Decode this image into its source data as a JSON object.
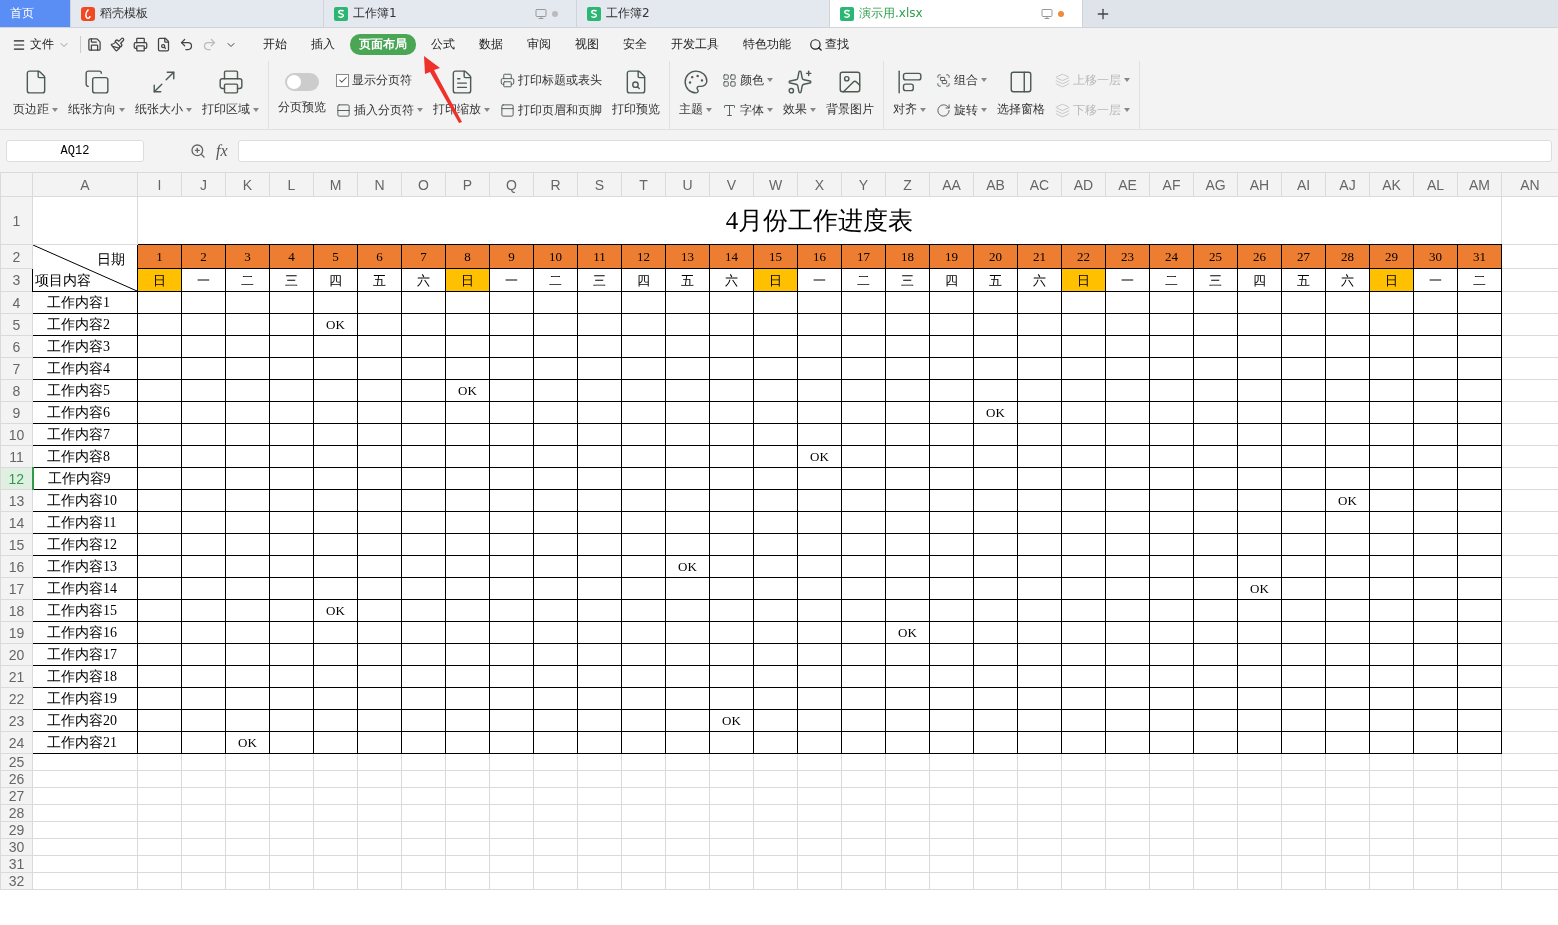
{
  "tabs": [
    {
      "label": "首页",
      "kind": "home",
      "selected": false
    },
    {
      "label": "稻壳模板",
      "kind": "docer",
      "selected": false
    },
    {
      "label": "工作簿1",
      "kind": "sheet",
      "selected": false,
      "modified": false
    },
    {
      "label": "工作簿2",
      "kind": "sheet",
      "selected": false
    },
    {
      "label": "演示用.xlsx",
      "kind": "sheet",
      "selected": true,
      "modified": true
    }
  ],
  "menu": {
    "file": "文件",
    "items": [
      {
        "label": "开始",
        "selected": false
      },
      {
        "label": "插入",
        "selected": false
      },
      {
        "label": "页面布局",
        "selected": true
      },
      {
        "label": "公式",
        "selected": false
      },
      {
        "label": "数据",
        "selected": false
      },
      {
        "label": "审阅",
        "selected": false
      },
      {
        "label": "视图",
        "selected": false
      },
      {
        "label": "安全",
        "selected": false
      },
      {
        "label": "开发工具",
        "selected": false
      },
      {
        "label": "特色功能",
        "selected": false
      }
    ],
    "search": "查找"
  },
  "ribbon": [
    [
      [
        {
          "kind": "large",
          "label": "页边距",
          "dropdown": true
        }
      ],
      [
        {
          "kind": "large",
          "label": "纸张方向",
          "dropdown": true
        }
      ],
      [
        {
          "kind": "large",
          "label": "纸张大小",
          "dropdown": true
        }
      ],
      [
        {
          "kind": "large",
          "label": "打印区域",
          "dropdown": true
        }
      ]
    ],
    [
      [
        {
          "kind": "toggle",
          "label": "分页预览",
          "on": false
        }
      ],
      [
        {
          "kind": "check",
          "label": "显示分页符",
          "checked": true
        },
        {
          "kind": "small",
          "label": "插入分页符",
          "dropdown": true
        }
      ],
      [
        {
          "kind": "large",
          "label": "打印缩放",
          "dropdown": true
        }
      ],
      [
        {
          "kind": "small",
          "label": "打印标题或表头"
        },
        {
          "kind": "small",
          "label": "打印页眉和页脚"
        }
      ],
      [
        {
          "kind": "large",
          "label": "打印预览"
        }
      ]
    ],
    [
      [
        {
          "kind": "large",
          "label": "主题",
          "dropdown": true
        }
      ],
      [
        {
          "kind": "small",
          "label": "颜色",
          "dropdown": true
        },
        {
          "kind": "small",
          "label": "字体",
          "dropdown": true
        }
      ],
      [
        {
          "kind": "large",
          "label": "效果",
          "dropdown": true
        }
      ],
      [
        {
          "kind": "large",
          "label": "背景图片"
        }
      ]
    ],
    [
      [
        {
          "kind": "large",
          "label": "对齐",
          "dropdown": true
        }
      ],
      [
        {
          "kind": "small",
          "label": "组合",
          "dropdown": true
        },
        {
          "kind": "small",
          "label": "旋转",
          "dropdown": true
        }
      ],
      [
        {
          "kind": "large",
          "label": "选择窗格"
        }
      ],
      [
        {
          "kind": "small",
          "label": "上移一层",
          "dropdown": true,
          "disabled": true
        },
        {
          "kind": "small",
          "label": "下移一层",
          "dropdown": true,
          "disabled": true
        }
      ]
    ]
  ],
  "formula_bar": {
    "name_box": "AQ12",
    "fx": "fx"
  },
  "sheet": {
    "columns": [
      "A",
      "I",
      "J",
      "K",
      "L",
      "M",
      "N",
      "O",
      "P",
      "Q",
      "R",
      "S",
      "T",
      "U",
      "V",
      "W",
      "X",
      "Y",
      "Z",
      "AA",
      "AB",
      "AC",
      "AD",
      "AE",
      "AF",
      "AG",
      "AH",
      "AI",
      "AJ",
      "AK",
      "AL",
      "AM",
      "AN"
    ],
    "rows": [
      {
        "n": "1",
        "selected": false
      },
      {
        "n": "2",
        "selected": false
      },
      {
        "n": "3",
        "selected": false
      },
      {
        "n": "4",
        "selected": false
      },
      {
        "n": "5",
        "selected": false
      },
      {
        "n": "6",
        "selected": false
      },
      {
        "n": "7",
        "selected": false
      },
      {
        "n": "8",
        "selected": false
      },
      {
        "n": "9",
        "selected": false
      },
      {
        "n": "10",
        "selected": false
      },
      {
        "n": "11",
        "selected": false
      },
      {
        "n": "12",
        "selected": true
      },
      {
        "n": "13",
        "selected": false
      },
      {
        "n": "14",
        "selected": false
      },
      {
        "n": "15",
        "selected": false
      },
      {
        "n": "16",
        "selected": false
      },
      {
        "n": "17",
        "selected": false
      },
      {
        "n": "18",
        "selected": false
      },
      {
        "n": "19",
        "selected": false
      },
      {
        "n": "20",
        "selected": false
      },
      {
        "n": "21",
        "selected": false
      },
      {
        "n": "22",
        "selected": false
      },
      {
        "n": "23",
        "selected": false
      },
      {
        "n": "24",
        "selected": false
      },
      {
        "n": "25",
        "selected": false
      },
      {
        "n": "26",
        "selected": false
      },
      {
        "n": "27",
        "selected": false
      },
      {
        "n": "28",
        "selected": false
      },
      {
        "n": "29",
        "selected": false
      },
      {
        "n": "30",
        "selected": false
      },
      {
        "n": "31",
        "selected": false
      },
      {
        "n": "32",
        "selected": false
      }
    ],
    "title": "4月份工作进度表",
    "corner_top": "日期",
    "corner_bottom": "项目内容",
    "days": [
      {
        "day": "1",
        "weekday": "日",
        "highlight": true
      },
      {
        "day": "2",
        "weekday": "一",
        "highlight": false
      },
      {
        "day": "3",
        "weekday": "二",
        "highlight": false
      },
      {
        "day": "4",
        "weekday": "三",
        "highlight": false
      },
      {
        "day": "5",
        "weekday": "四",
        "highlight": false
      },
      {
        "day": "6",
        "weekday": "五",
        "highlight": false
      },
      {
        "day": "7",
        "weekday": "六",
        "highlight": false
      },
      {
        "day": "8",
        "weekday": "日",
        "highlight": true
      },
      {
        "day": "9",
        "weekday": "一",
        "highlight": false
      },
      {
        "day": "10",
        "weekday": "二",
        "highlight": false
      },
      {
        "day": "11",
        "weekday": "三",
        "highlight": false
      },
      {
        "day": "12",
        "weekday": "四",
        "highlight": false
      },
      {
        "day": "13",
        "weekday": "五",
        "highlight": false
      },
      {
        "day": "14",
        "weekday": "六",
        "highlight": false
      },
      {
        "day": "15",
        "weekday": "日",
        "highlight": true
      },
      {
        "day": "16",
        "weekday": "一",
        "highlight": false
      },
      {
        "day": "17",
        "weekday": "二",
        "highlight": false
      },
      {
        "day": "18",
        "weekday": "三",
        "highlight": false
      },
      {
        "day": "19",
        "weekday": "四",
        "highlight": false
      },
      {
        "day": "20",
        "weekday": "五",
        "highlight": false
      },
      {
        "day": "21",
        "weekday": "六",
        "highlight": false
      },
      {
        "day": "22",
        "weekday": "日",
        "highlight": true
      },
      {
        "day": "23",
        "weekday": "一",
        "highlight": false
      },
      {
        "day": "24",
        "weekday": "二",
        "highlight": false
      },
      {
        "day": "25",
        "weekday": "三",
        "highlight": false
      },
      {
        "day": "26",
        "weekday": "四",
        "highlight": false
      },
      {
        "day": "27",
        "weekday": "五",
        "highlight": false
      },
      {
        "day": "28",
        "weekday": "六",
        "highlight": false
      },
      {
        "day": "29",
        "weekday": "日",
        "highlight": true
      },
      {
        "day": "30",
        "weekday": "一",
        "highlight": false
      },
      {
        "day": "31",
        "weekday": "二",
        "highlight": false
      }
    ],
    "tasks": [
      {
        "label": "工作内容1",
        "cells": [
          null,
          null,
          null,
          null,
          null,
          null,
          null,
          null,
          null,
          null,
          null,
          null,
          null,
          null,
          null,
          null,
          null,
          null,
          null,
          null,
          null,
          null,
          null,
          null,
          null,
          null,
          null,
          null,
          null,
          null,
          null
        ]
      },
      {
        "label": "工作内容2",
        "cells": [
          null,
          null,
          null,
          null,
          "OK",
          null,
          null,
          null,
          null,
          null,
          null,
          null,
          null,
          null,
          null,
          null,
          null,
          null,
          null,
          null,
          null,
          null,
          null,
          null,
          null,
          null,
          null,
          null,
          null,
          null,
          null
        ]
      },
      {
        "label": "工作内容3",
        "cells": [
          null,
          null,
          null,
          null,
          null,
          null,
          null,
          null,
          null,
          null,
          null,
          null,
          null,
          null,
          null,
          null,
          null,
          null,
          null,
          null,
          null,
          null,
          null,
          null,
          null,
          null,
          null,
          null,
          null,
          null,
          null
        ]
      },
      {
        "label": "工作内容4",
        "cells": [
          null,
          null,
          null,
          null,
          null,
          null,
          null,
          null,
          null,
          null,
          null,
          null,
          null,
          null,
          null,
          null,
          null,
          null,
          null,
          null,
          null,
          null,
          null,
          null,
          null,
          null,
          null,
          null,
          null,
          null,
          null
        ]
      },
      {
        "label": "工作内容5",
        "cells": [
          null,
          null,
          null,
          null,
          null,
          null,
          null,
          "OK",
          null,
          null,
          null,
          null,
          null,
          null,
          null,
          null,
          null,
          null,
          null,
          null,
          null,
          null,
          null,
          null,
          null,
          null,
          null,
          null,
          null,
          null,
          null
        ]
      },
      {
        "label": "工作内容6",
        "cells": [
          null,
          null,
          null,
          null,
          null,
          null,
          null,
          null,
          null,
          null,
          null,
          null,
          null,
          null,
          null,
          null,
          null,
          null,
          null,
          "OK",
          null,
          null,
          null,
          null,
          null,
          null,
          null,
          null,
          null,
          null,
          null
        ]
      },
      {
        "label": "工作内容7",
        "cells": [
          null,
          null,
          null,
          null,
          null,
          null,
          null,
          null,
          null,
          null,
          null,
          null,
          null,
          null,
          null,
          null,
          null,
          null,
          null,
          null,
          null,
          null,
          null,
          null,
          null,
          null,
          null,
          null,
          null,
          null,
          null
        ]
      },
      {
        "label": "工作内容8",
        "cells": [
          null,
          null,
          null,
          null,
          null,
          null,
          null,
          null,
          null,
          null,
          null,
          null,
          null,
          null,
          null,
          "OK",
          null,
          null,
          null,
          null,
          null,
          null,
          null,
          null,
          null,
          null,
          null,
          null,
          null,
          null,
          null
        ]
      },
      {
        "label": "工作内容9",
        "cells": [
          null,
          null,
          null,
          null,
          null,
          null,
          null,
          null,
          null,
          null,
          null,
          null,
          null,
          null,
          null,
          null,
          null,
          null,
          null,
          null,
          null,
          null,
          null,
          null,
          null,
          null,
          null,
          null,
          null,
          null,
          null
        ]
      },
      {
        "label": "工作内容10",
        "cells": [
          null,
          null,
          null,
          null,
          null,
          null,
          null,
          null,
          null,
          null,
          null,
          null,
          null,
          null,
          null,
          null,
          null,
          null,
          null,
          null,
          null,
          null,
          null,
          null,
          null,
          null,
          null,
          "OK",
          null,
          null,
          null
        ]
      },
      {
        "label": "工作内容11",
        "cells": [
          null,
          null,
          null,
          null,
          null,
          null,
          null,
          null,
          null,
          null,
          null,
          null,
          null,
          null,
          null,
          null,
          null,
          null,
          null,
          null,
          null,
          null,
          null,
          null,
          null,
          null,
          null,
          null,
          null,
          null,
          null
        ]
      },
      {
        "label": "工作内容12",
        "cells": [
          null,
          null,
          null,
          null,
          null,
          null,
          null,
          null,
          null,
          null,
          null,
          null,
          null,
          null,
          null,
          null,
          null,
          null,
          null,
          null,
          null,
          null,
          null,
          null,
          null,
          null,
          null,
          null,
          null,
          null,
          null
        ]
      },
      {
        "label": "工作内容13",
        "cells": [
          null,
          null,
          null,
          null,
          null,
          null,
          null,
          null,
          null,
          null,
          null,
          null,
          "OK",
          null,
          null,
          null,
          null,
          null,
          null,
          null,
          null,
          null,
          null,
          null,
          null,
          null,
          null,
          null,
          null,
          null,
          null
        ]
      },
      {
        "label": "工作内容14",
        "cells": [
          null,
          null,
          null,
          null,
          null,
          null,
          null,
          null,
          null,
          null,
          null,
          null,
          null,
          null,
          null,
          null,
          null,
          null,
          null,
          null,
          null,
          null,
          null,
          null,
          null,
          "OK",
          null,
          null,
          null,
          null,
          null
        ]
      },
      {
        "label": "工作内容15",
        "cells": [
          null,
          null,
          null,
          null,
          "OK",
          null,
          null,
          null,
          null,
          null,
          null,
          null,
          null,
          null,
          null,
          null,
          null,
          null,
          null,
          null,
          null,
          null,
          null,
          null,
          null,
          null,
          null,
          null,
          null,
          null,
          null
        ]
      },
      {
        "label": "工作内容16",
        "cells": [
          null,
          null,
          null,
          null,
          null,
          null,
          null,
          null,
          null,
          null,
          null,
          null,
          null,
          null,
          null,
          null,
          null,
          "OK",
          null,
          null,
          null,
          null,
          null,
          null,
          null,
          null,
          null,
          null,
          null,
          null,
          null
        ]
      },
      {
        "label": "工作内容17",
        "cells": [
          null,
          null,
          null,
          null,
          null,
          null,
          null,
          null,
          null,
          null,
          null,
          null,
          null,
          null,
          null,
          null,
          null,
          null,
          null,
          null,
          null,
          null,
          null,
          null,
          null,
          null,
          null,
          null,
          null,
          null,
          null
        ]
      },
      {
        "label": "工作内容18",
        "cells": [
          null,
          null,
          null,
          null,
          null,
          null,
          null,
          null,
          null,
          null,
          null,
          null,
          null,
          null,
          null,
          null,
          null,
          null,
          null,
          null,
          null,
          null,
          null,
          null,
          null,
          null,
          null,
          null,
          null,
          null,
          null
        ]
      },
      {
        "label": "工作内容19",
        "cells": [
          null,
          null,
          null,
          null,
          null,
          null,
          null,
          null,
          null,
          null,
          null,
          null,
          null,
          null,
          null,
          null,
          null,
          null,
          null,
          null,
          null,
          null,
          null,
          null,
          null,
          null,
          null,
          null,
          null,
          null,
          null
        ]
      },
      {
        "label": "工作内容20",
        "cells": [
          null,
          null,
          null,
          null,
          null,
          null,
          null,
          null,
          null,
          null,
          null,
          null,
          null,
          "OK",
          null,
          null,
          null,
          null,
          null,
          null,
          null,
          null,
          null,
          null,
          null,
          null,
          null,
          null,
          null,
          null,
          null
        ]
      },
      {
        "label": "工作内容21",
        "cells": [
          null,
          null,
          "OK",
          null,
          null,
          null,
          null,
          null,
          null,
          null,
          null,
          null,
          null,
          null,
          null,
          null,
          null,
          null,
          null,
          null,
          null,
          null,
          null,
          null,
          null,
          null,
          null,
          null,
          null,
          null,
          null
        ]
      }
    ]
  }
}
